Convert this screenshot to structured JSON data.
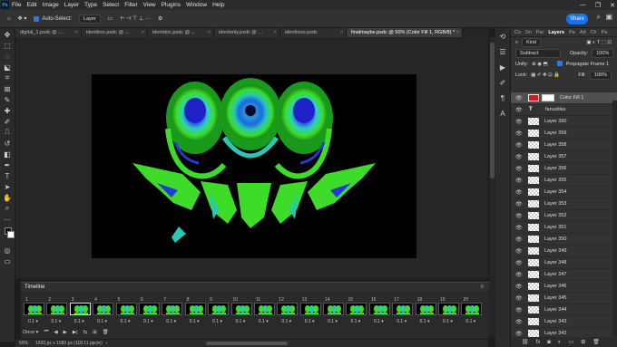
{
  "app": {
    "logo_label": "Ps"
  },
  "menubar": {
    "items": [
      "File",
      "Edit",
      "Image",
      "Layer",
      "Type",
      "Select",
      "Filter",
      "View",
      "Plugins",
      "Window",
      "Help"
    ],
    "window_controls": [
      "—",
      "❐",
      "✕"
    ]
  },
  "options_bar": {
    "auto_select_label": "Auto-Select:",
    "auto_select_value": "Layer",
    "share_label": "Share"
  },
  "tabs": [
    {
      "label": "digital_1.psdc @ ...",
      "active": false
    },
    {
      "label": "identitoo.psdc @ ...",
      "active": false
    },
    {
      "label": "identdoc.psdc @ ...",
      "active": false
    },
    {
      "label": "identonly.psdc @ ...",
      "active": false
    },
    {
      "label": "identtooo.psdc",
      "active": false
    },
    {
      "label": "finalmaybe.psdc @ 50% (Color Fill 1, RGB/8) *",
      "active": true
    }
  ],
  "timeline": {
    "title": "Timeline",
    "frames": [
      {
        "n": "1",
        "delay": "0.1"
      },
      {
        "n": "2",
        "delay": "0.1"
      },
      {
        "n": "3",
        "delay": "0.1"
      },
      {
        "n": "4",
        "delay": "0.1"
      },
      {
        "n": "5",
        "delay": "0.1"
      },
      {
        "n": "6",
        "delay": "0.1"
      },
      {
        "n": "7",
        "delay": "0.1"
      },
      {
        "n": "8",
        "delay": "0.1"
      },
      {
        "n": "9",
        "delay": "0.1"
      },
      {
        "n": "10",
        "delay": "0.1"
      },
      {
        "n": "11",
        "delay": "0.1"
      },
      {
        "n": "12",
        "delay": "0.1"
      },
      {
        "n": "13",
        "delay": "0.1"
      },
      {
        "n": "14",
        "delay": "0.1"
      },
      {
        "n": "15",
        "delay": "0.1"
      },
      {
        "n": "16",
        "delay": "0.1"
      },
      {
        "n": "17",
        "delay": "0.1"
      },
      {
        "n": "18",
        "delay": "0.1"
      },
      {
        "n": "19",
        "delay": "0.1"
      },
      {
        "n": "20",
        "delay": "0.1"
      }
    ],
    "loop_label": "Once"
  },
  "status": {
    "zoom": "50%",
    "doc_info": "1920 px x 1080 px (118.11 ppcm)"
  },
  "layers_panel": {
    "tabs": [
      "Co",
      "Sn",
      "Par",
      "Layers",
      "Pa",
      "Ad",
      "Ch",
      "Pa"
    ],
    "active_tab": "Layers",
    "filter_label": "Kind",
    "blend_mode": "Subtract",
    "opacity_label": "Opacity:",
    "opacity_value": "100%",
    "unify_label": "Unify:",
    "propagate_label": "Propagate Frame 1",
    "lock_label": "Lock:",
    "fill_label": "Fill:",
    "fill_value": "100%",
    "layers": [
      {
        "name": "Color Fill 1",
        "kind": "fill",
        "selected": true
      },
      {
        "name": "fanushka",
        "kind": "text",
        "selected": false
      },
      {
        "name": "Layer 360",
        "kind": "pixel",
        "selected": false
      },
      {
        "name": "Layer 359",
        "kind": "pixel",
        "selected": false
      },
      {
        "name": "Layer 358",
        "kind": "pixel",
        "selected": false
      },
      {
        "name": "Layer 357",
        "kind": "pixel",
        "selected": false
      },
      {
        "name": "Layer 356",
        "kind": "pixel",
        "selected": false
      },
      {
        "name": "Layer 355",
        "kind": "pixel",
        "selected": false
      },
      {
        "name": "Layer 354",
        "kind": "pixel",
        "selected": false
      },
      {
        "name": "Layer 353",
        "kind": "pixel",
        "selected": false
      },
      {
        "name": "Layer 352",
        "kind": "pixel",
        "selected": false
      },
      {
        "name": "Layer 351",
        "kind": "pixel",
        "selected": false
      },
      {
        "name": "Layer 350",
        "kind": "pixel",
        "selected": false
      },
      {
        "name": "Layer 349",
        "kind": "pixel",
        "selected": false
      },
      {
        "name": "Layer 348",
        "kind": "pixel",
        "selected": false
      },
      {
        "name": "Layer 347",
        "kind": "pixel",
        "selected": false
      },
      {
        "name": "Layer 346",
        "kind": "pixel",
        "selected": false
      },
      {
        "name": "Layer 345",
        "kind": "pixel",
        "selected": false
      },
      {
        "name": "Layer 344",
        "kind": "pixel",
        "selected": false
      },
      {
        "name": "Layer 343",
        "kind": "pixel",
        "selected": false
      },
      {
        "name": "Layer 342",
        "kind": "pixel",
        "selected": false
      }
    ],
    "fx_label": "fx"
  },
  "colors": {
    "accent": "#1473e6",
    "fill_swatch": "#e0141e",
    "art_green": "#3cdc28",
    "art_blue": "#2838d8",
    "art_teal": "#28c8b4"
  }
}
